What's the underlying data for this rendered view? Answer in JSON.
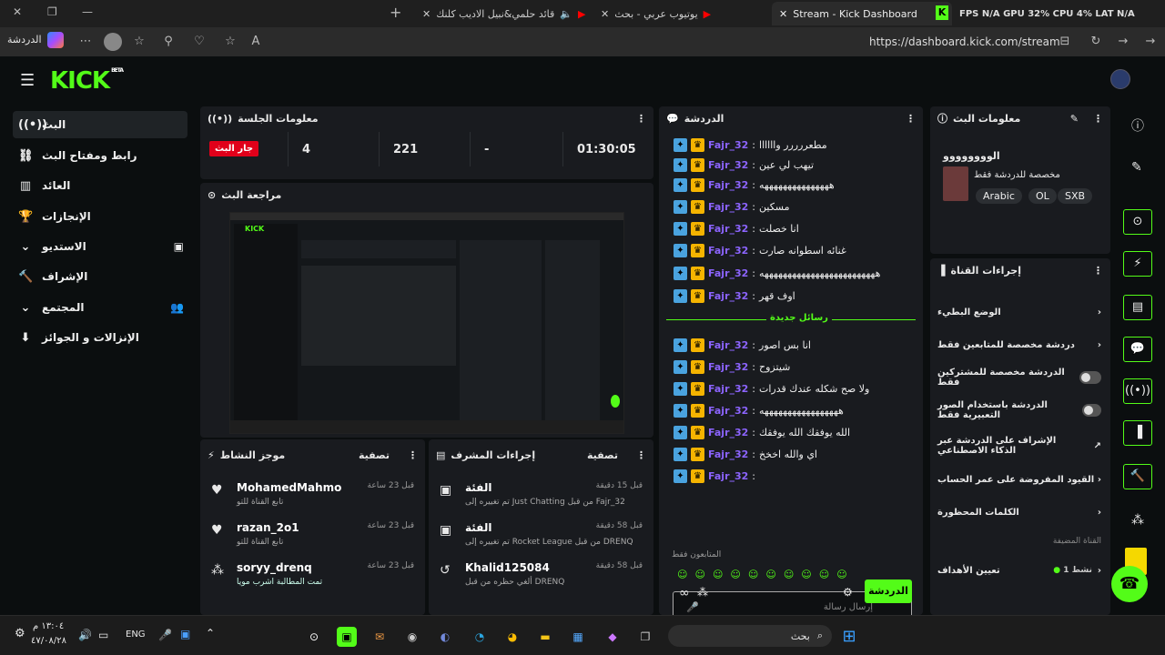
{
  "browser": {
    "tabs": [
      {
        "label": "Stream - Kick Dashboard",
        "active": true
      },
      {
        "label": "يوتيوب عربي - بحث"
      },
      {
        "label": "قائد حلمي&نبيل الاديب كلنك"
      }
    ],
    "overlay": "FPS N/A  GPU 32%  CPU 4%  LAT N/A",
    "url": "https://dashboard.kick.com/stream",
    "profile_label": "الدردشة",
    "window_controls": {
      "minimize": "—",
      "restore": "❐",
      "close": "✕"
    }
  },
  "sidebar": {
    "logo": "KICK",
    "logo_badge": "BETA",
    "items": [
      {
        "label": "البث",
        "icon": "live-icon",
        "active": true
      },
      {
        "label": "رابط ومفتاح البث",
        "icon": "link-icon"
      },
      {
        "label": "العائد",
        "icon": "revenue-icon"
      },
      {
        "label": "الإنجازات",
        "icon": "trophy-icon"
      },
      {
        "label": "الاستديو",
        "icon": "studio-icon",
        "expandable": true
      },
      {
        "label": "الإشراف",
        "icon": "moderation-icon"
      },
      {
        "label": "المجتمع",
        "icon": "community-icon",
        "expandable": true
      },
      {
        "label": "الإنزالات و الجوائز",
        "icon": "drops-icon"
      }
    ]
  },
  "session": {
    "title": "معلومات الجلسة",
    "live_label": "جار البث",
    "stats": [
      "4",
      "221",
      "-",
      "01:30:05"
    ]
  },
  "preview": {
    "title": "مراجعة البث"
  },
  "activity": {
    "title": "موجز النشاط",
    "filter": "تصفية",
    "items": [
      {
        "name": "MohamedMahmo",
        "sub": "تابع القناة للتو",
        "time": "قبل 23 ساعة",
        "icon": "heart-icon"
      },
      {
        "name": "razan_2o1",
        "sub": "تابع القناة للتو",
        "time": "قبل 23 ساعة",
        "icon": "heart-icon"
      },
      {
        "name": "soryy_drenq",
        "sub": "تمت المطالبة اشرب مويا",
        "time": "قبل 23 ساعة",
        "icon": "points-icon"
      }
    ]
  },
  "modactions": {
    "title": "إجراءات المشرف",
    "filter": "تصفية",
    "items": [
      {
        "name": "الفئة",
        "sub": "تم تغييره إلى Just Chatting من قبل Fajr_32",
        "time": "قبل 15 دقيقة"
      },
      {
        "name": "الفئة",
        "sub": "تم تغييره إلى Rocket League من قبل DRENQ",
        "time": "قبل 58 دقيقة"
      },
      {
        "name": "Khalid125084",
        "sub": "ألغي حظره من قبل DRENQ",
        "time": "قبل 58 دقيقة"
      }
    ]
  },
  "chat": {
    "title": "الدردشة",
    "new_messages": "رسائل جديدة",
    "followers_only": "المتابعون فقط",
    "placeholder": "إرسال رسالة",
    "send": "الدردشة",
    "messages": [
      {
        "user": "Fajr_32",
        "text": "مطعررررر واااااا"
      },
      {
        "user": "Fajr_32",
        "text": "تيهب لي عين"
      },
      {
        "user": "Fajr_32",
        "text": "هههههههههههههههه"
      },
      {
        "user": "Fajr_32",
        "text": "مسكين"
      },
      {
        "user": "Fajr_32",
        "text": "انا خصلت"
      },
      {
        "user": "Fajr_32",
        "text": "غنائه اسطوانه صارت"
      },
      {
        "user": "Fajr_32",
        "text": "هههههههههههههههههههههههههه"
      },
      {
        "user": "Fajr_32",
        "text": "اوف قهر"
      },
      {
        "user": "Fajr_32",
        "text": "انا بس اصور"
      },
      {
        "user": "Fajr_32",
        "text": "شيتزوح"
      },
      {
        "user": "Fajr_32",
        "text": "ولا صح شكله عندك قدرات"
      },
      {
        "user": "Fajr_32",
        "text": "هههههههههههههههههه"
      },
      {
        "user": "Fajr_32",
        "text": "الله يوفقك الله يوفقك"
      },
      {
        "user": "Fajr_32",
        "text": "اي والله اخخخ"
      },
      {
        "user": "Fajr_32",
        "text": ""
      }
    ]
  },
  "streaminfo": {
    "title": "معلومات البث",
    "stream_title": "الوووووووو",
    "desc": "مخصصة للدردشة فقط",
    "tags": [
      "Arabic",
      "OL",
      "SXB"
    ]
  },
  "channel": {
    "title": "إجراءات القناة",
    "rows": [
      {
        "label": "الوضع البطيء",
        "type": "chevron"
      },
      {
        "label": "دردشة مخصصة للمتابعين فقط",
        "type": "chevron"
      },
      {
        "label": "الدردشة مخصصة للمشتركين فقط",
        "type": "toggle"
      },
      {
        "label": "الدردشة باستخدام الصور التعبيرية فقط",
        "type": "toggle"
      },
      {
        "label": "الإشراف على الدردشة عبر الذكاء الاصطناعي",
        "type": "external"
      },
      {
        "label": "القيود المفروضة على عمر الحساب",
        "type": "chevron"
      },
      {
        "label": "الكلمات المحظورة",
        "type": "chevron"
      }
    ],
    "host_label": "القناة المضيفة",
    "goals_label": "تعيين الأهداف",
    "goals_status": "نشط 1"
  },
  "taskbar": {
    "time": "١٣:٠٤ م",
    "date": "٤٧/٠٨/٢٨",
    "lang": "ENG",
    "search": "بحث"
  }
}
